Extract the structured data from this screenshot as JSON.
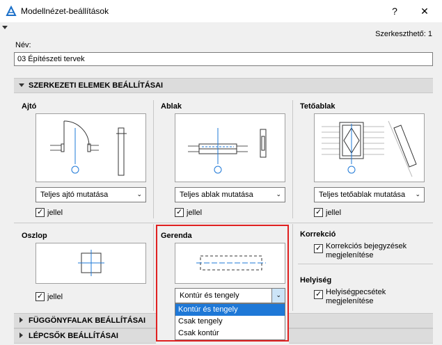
{
  "window": {
    "title": "Modellnézet-beállítások",
    "help_label": "?",
    "close_label": "✕"
  },
  "header": {
    "editable_label": "Szerkeszthető: 1"
  },
  "name_field": {
    "label": "Név:",
    "value": "03 Építészeti tervek"
  },
  "sections": {
    "structural": "SZERKEZETI ELEMEK BEÁLLÍTÁSAI",
    "curtain": "FÜGGÖNYFALAK BEÁLLÍTÁSAI",
    "stairs": "LÉPCSŐK BEÁLLÍTÁSAI"
  },
  "door": {
    "title": "Ajtó",
    "dropdown": "Teljes ajtó mutatása",
    "check_label": "jellel"
  },
  "window_panel": {
    "title": "Ablak",
    "dropdown": "Teljes ablak mutatása",
    "check_label": "jellel"
  },
  "skylight": {
    "title": "Tetőablak",
    "dropdown": "Teljes tetőablak mutatása",
    "check_label": "jellel"
  },
  "column": {
    "title": "Oszlop",
    "check_label": "jellel"
  },
  "beam": {
    "title": "Gerenda",
    "dropdown": "Kontúr és tengely",
    "options": [
      "Kontúr és tengely",
      "Csak tengely",
      "Csak kontúr"
    ]
  },
  "correction": {
    "title": "Korrekció",
    "check_label": "Korrekciós bejegyzések megjelenítése"
  },
  "location": {
    "title": "Helyiség",
    "check_label": "Helyiségpecsétek megjelenítése"
  },
  "colors": {
    "selection": "#1e78d7",
    "highlight": "#e02020",
    "symbol_blue": "#1e78d7"
  }
}
